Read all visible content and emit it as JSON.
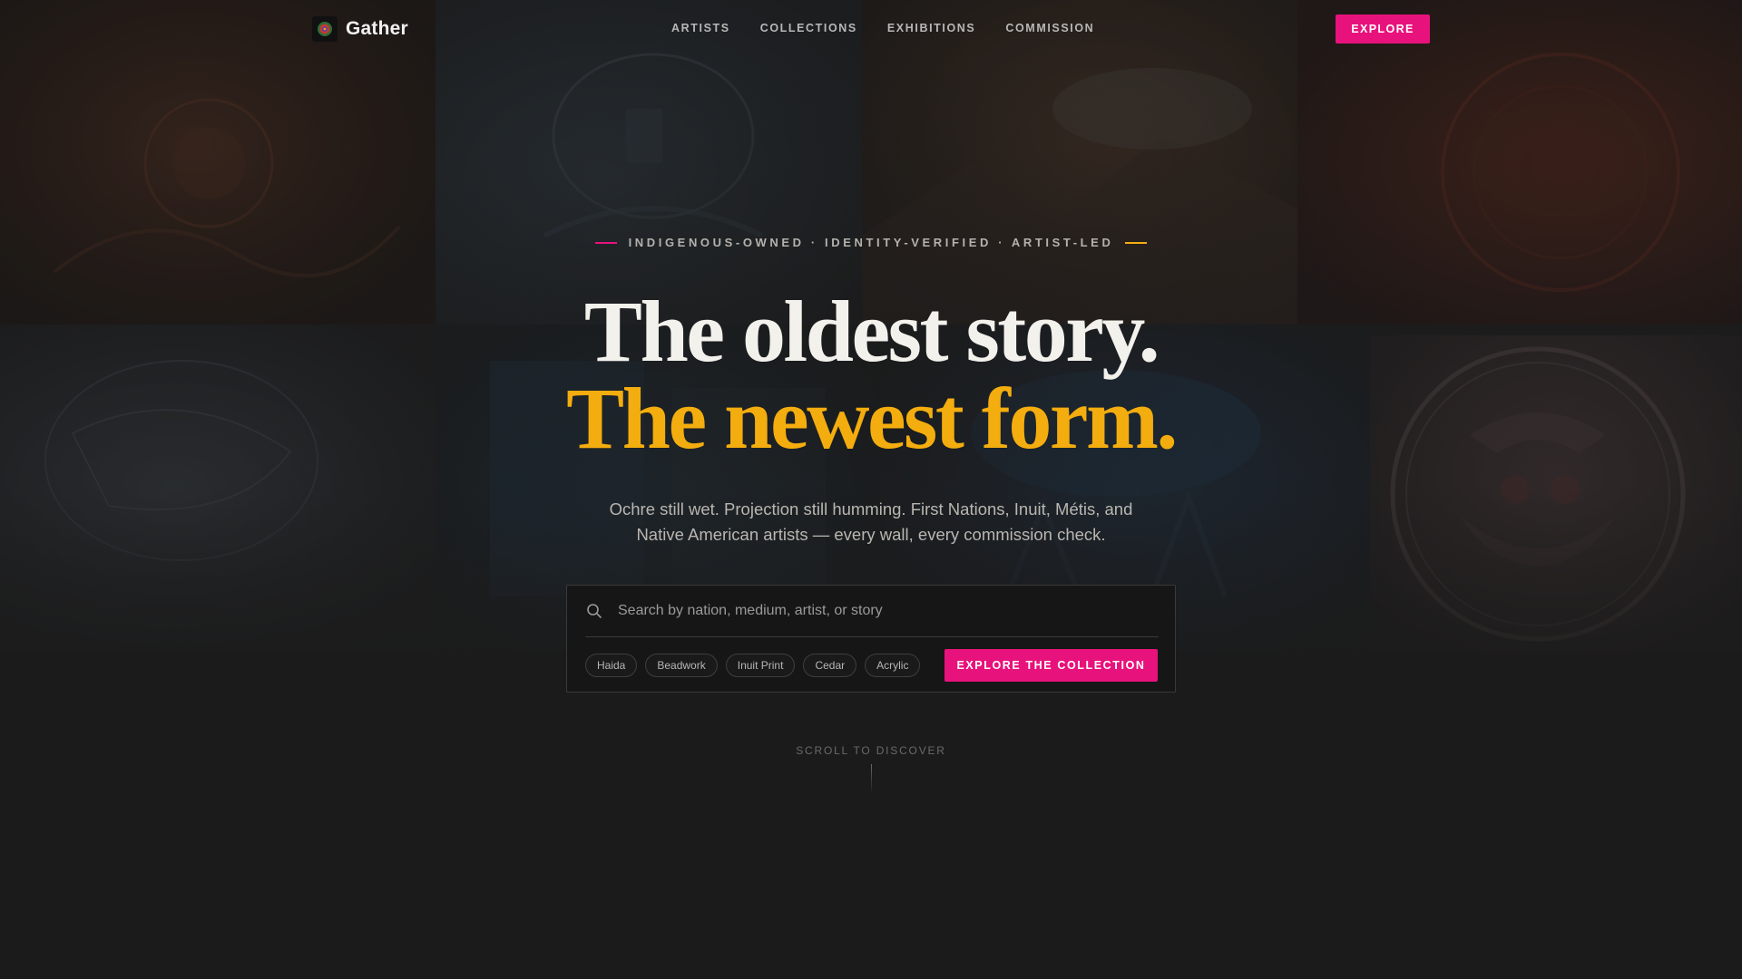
{
  "brand": {
    "name": "Gather",
    "logo_icon": "sun-mandala-icon"
  },
  "nav": {
    "links": [
      "ARTISTS",
      "COLLECTIONS",
      "EXHIBITIONS",
      "COMMISSION"
    ],
    "cta_label": "EXPLORE"
  },
  "hero": {
    "eyebrow": "INDIGENOUS-OWNED · IDENTITY-VERIFIED · ARTIST-LED",
    "headline_line1": "The oldest story.",
    "headline_line2": "The newest form.",
    "subtitle": "Ochre still wet. Projection still humming. First Nations, Inuit, Métis, and Native American artists — every wall, every commission check."
  },
  "search": {
    "placeholder": "Search by nation, medium, artist, or story",
    "value": "",
    "icon": "search-icon",
    "chips": [
      "Haida",
      "Beadwork",
      "Inuit Print",
      "Cedar",
      "Acrylic"
    ],
    "submit_label": "EXPLORE THE COLLECTION"
  },
  "scroll_hint": "SCROLL TO DISCOVER",
  "colors": {
    "accent_pink": "#e8127c",
    "accent_amber": "#f4ad0e",
    "background": "#1c1c1c",
    "eyebrow_line_left": "#e8127c",
    "eyebrow_line_right": "#f4ad0e"
  }
}
